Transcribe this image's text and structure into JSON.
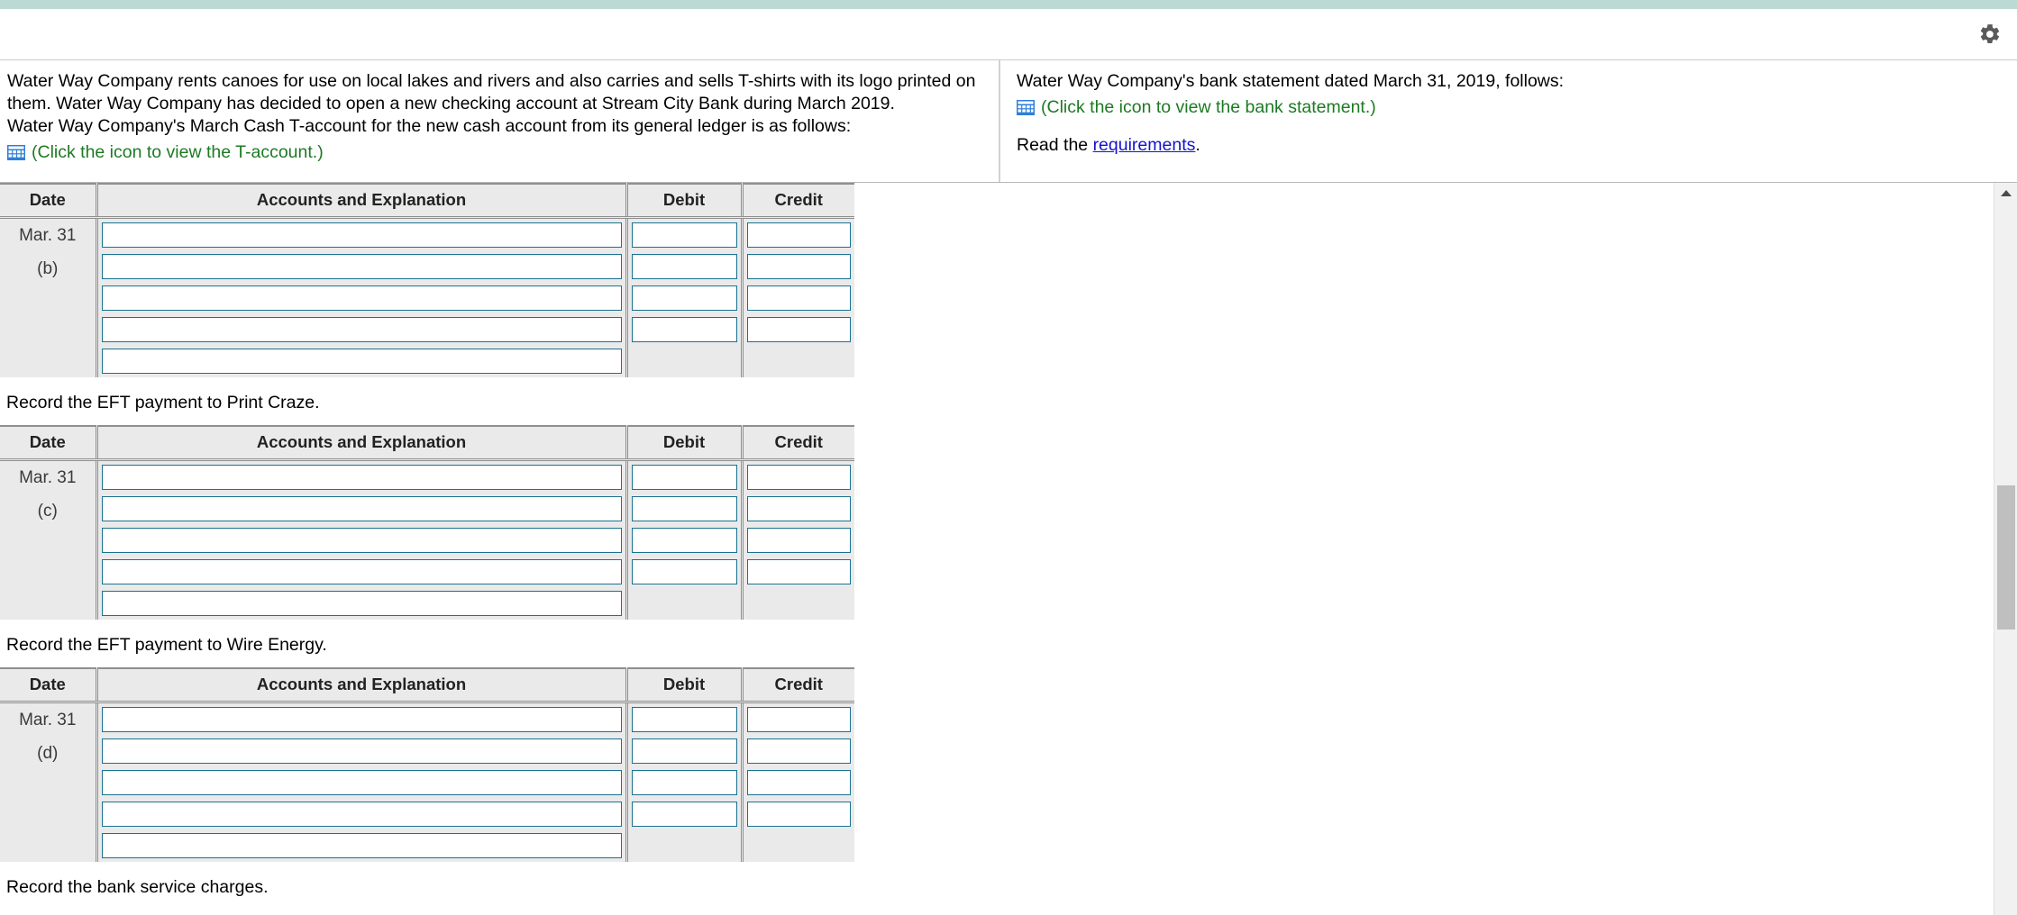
{
  "app": {
    "accent_teal": "#bdd9d4",
    "link_green": "#1d7a23",
    "link_blue": "#1414cf",
    "input_border": "#1a7290"
  },
  "toolbar": {
    "settings_icon": "gear-icon",
    "settings_label": "Settings"
  },
  "statement": {
    "left": {
      "paragraph_line1": "Water Way Company rents canoes for use on local lakes and rivers and also carries and sells T-shirts with its logo printed on",
      "paragraph_line2": "them. Water Way Company has decided to open a new checking account at Stream City Bank during March 2019.",
      "paragraph_line3": "Water Way Company's March Cash T-account for the new cash account from its general ledger is as follows:",
      "icon_name": "table-grid-icon",
      "link_text": "(Click the icon to view the T-account.)"
    },
    "right": {
      "paragraph_line1": "Water Way Company's bank statement dated March 31, 2019, follows:",
      "icon_name": "table-grid-icon",
      "link_text": "(Click the icon to view the bank statement.)",
      "read_prefix": "Read the ",
      "read_link": "requirements",
      "read_suffix": "."
    }
  },
  "journal": {
    "columns": [
      "Date",
      "Accounts and Explanation",
      "Debit",
      "Credit"
    ],
    "entries": [
      {
        "id": "entry-b",
        "date_line1": "Mar. 31",
        "date_line2": "(b)",
        "rows": 5,
        "amount_rows": 4,
        "caption_after": "Record the EFT payment to Print Craze."
      },
      {
        "id": "entry-c",
        "date_line1": "Mar. 31",
        "date_line2": "(c)",
        "rows": 5,
        "amount_rows": 4,
        "caption_after": "Record the EFT payment to Wire Energy."
      },
      {
        "id": "entry-d",
        "date_line1": "Mar. 31",
        "date_line2": "(d)",
        "rows": 5,
        "amount_rows": 4,
        "caption_after": "Record the bank service charges."
      }
    ]
  },
  "scrollbar": {
    "up_arrow": "triangle-up-icon",
    "thumb_label": "vertical-scroll-thumb"
  }
}
